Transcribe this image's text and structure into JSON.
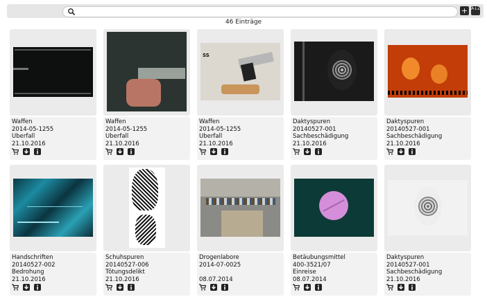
{
  "header": {
    "search": {
      "value": "",
      "placeholder": ""
    },
    "add_button_glyph": "+",
    "sort_button_glyph": "A↓Z",
    "entries_label": "46 Einträge"
  },
  "cards": [
    {
      "category": "Waffen",
      "number": "2014-05-1255",
      "offense": "Überfall",
      "date": "21.10.2016"
    },
    {
      "category": "Waffen",
      "number": "2014-05-1255",
      "offense": "Überfall",
      "date": "21.10.2016"
    },
    {
      "category": "Waffen",
      "number": "2014-05-1255",
      "offense": "Überfall",
      "date": "21.10.2016"
    },
    {
      "category": "Daktyspuren",
      "number": "20140527-001",
      "offense": "Sachbeschädigung",
      "date": "21.10.2016"
    },
    {
      "category": "Daktyspuren",
      "number": "20140527-001",
      "offense": "Sachbeschädigung",
      "date": "21.10.2016"
    },
    {
      "category": "Handschriften",
      "number": "20140527-002",
      "offense": "Bedrohung",
      "date": "21.10.2016"
    },
    {
      "category": "Schuhspuren",
      "number": "20140527-006",
      "offense": "Tötungsdelikt",
      "date": "21.10.2016"
    },
    {
      "category": "Drogenlabore",
      "number": "2014-07-0025",
      "offense": "",
      "date": "08.07.2014"
    },
    {
      "category": "Betäubungsmittel",
      "number": "400-3521/07",
      "offense": "Einreise",
      "date": "08.07.2014"
    },
    {
      "category": "Daktyspuren",
      "number": "20140527-001",
      "offense": "Sachbeschädigung",
      "date": "21.10.2016"
    }
  ],
  "card_photo_stamp_card3": "SS",
  "colors": {
    "toolbar_bg": "#e6e6e6",
    "card_bg": "#ebebeb",
    "icon_dark": "#222222"
  }
}
